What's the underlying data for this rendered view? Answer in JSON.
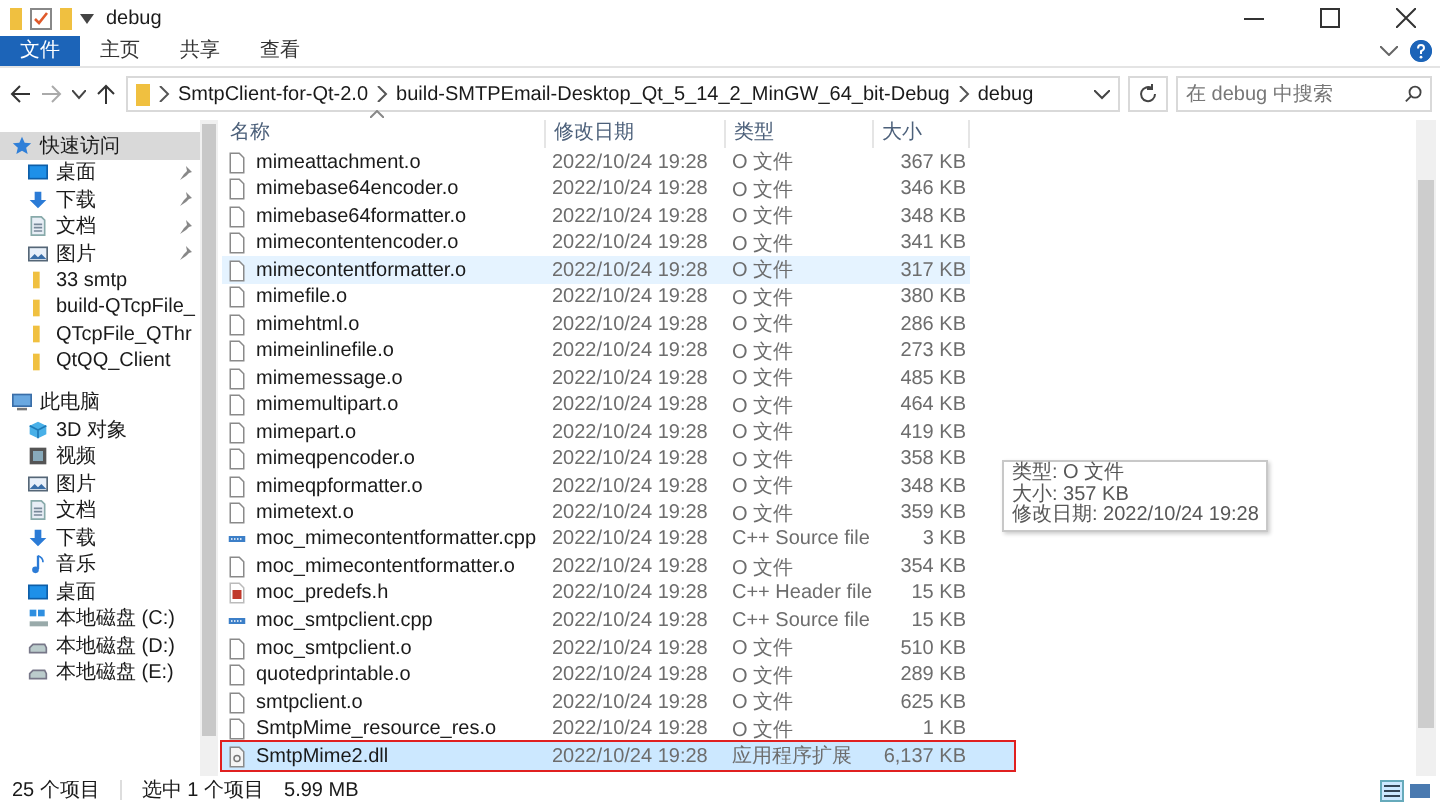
{
  "window": {
    "title": "debug"
  },
  "ribbon_tabs": [
    {
      "label": "文件",
      "selected": true
    },
    {
      "label": "主页",
      "selected": false
    },
    {
      "label": "共享",
      "selected": false
    },
    {
      "label": "查看",
      "selected": false
    }
  ],
  "address_bar": {
    "crumbs": [
      "SmtpClient-for-Qt-2.0",
      "build-SMTPEmail-Desktop_Qt_5_14_2_MinGW_64_bit-Debug",
      "debug"
    ]
  },
  "search": {
    "placeholder": "在 debug 中搜索"
  },
  "sidebar": {
    "items": [
      {
        "label": "快速访问",
        "kind": "star",
        "selected": true,
        "pinned": false,
        "children": [
          {
            "label": "桌面",
            "kind": "desktop",
            "selected": false,
            "pinned": true
          },
          {
            "label": "下载",
            "kind": "download",
            "selected": false,
            "pinned": true
          },
          {
            "label": "文档",
            "kind": "document",
            "selected": false,
            "pinned": true
          },
          {
            "label": "图片",
            "kind": "pictures",
            "selected": false,
            "pinned": true
          },
          {
            "label": "33 smtp",
            "kind": "folder",
            "selected": false,
            "pinned": false
          },
          {
            "label": "build-QTcpFile_",
            "kind": "folder",
            "selected": false,
            "pinned": false
          },
          {
            "label": "QTcpFile_QThr",
            "kind": "folder",
            "selected": false,
            "pinned": false
          },
          {
            "label": "QtQQ_Client",
            "kind": "folder",
            "selected": false,
            "pinned": false
          }
        ]
      },
      {
        "label": "此电脑",
        "kind": "pc",
        "selected": false,
        "pinned": false,
        "children": [
          {
            "label": "3D 对象",
            "kind": "cube",
            "selected": false,
            "pinned": false
          },
          {
            "label": "视频",
            "kind": "video",
            "selected": false,
            "pinned": false
          },
          {
            "label": "图片",
            "kind": "pictures",
            "selected": false,
            "pinned": false
          },
          {
            "label": "文档",
            "kind": "document",
            "selected": false,
            "pinned": false
          },
          {
            "label": "下载",
            "kind": "download",
            "selected": false,
            "pinned": false
          },
          {
            "label": "音乐",
            "kind": "music",
            "selected": false,
            "pinned": false
          },
          {
            "label": "桌面",
            "kind": "desktop",
            "selected": false,
            "pinned": false
          },
          {
            "label": "本地磁盘 (C:)",
            "kind": "sysdrive",
            "selected": false,
            "pinned": false
          },
          {
            "label": "本地磁盘 (D:)",
            "kind": "drive",
            "selected": false,
            "pinned": false
          },
          {
            "label": "本地磁盘 (E:)",
            "kind": "drive",
            "selected": false,
            "pinned": false
          }
        ]
      }
    ]
  },
  "table": {
    "columns": [
      "名称",
      "修改日期",
      "类型",
      "大小"
    ],
    "rows": [
      {
        "name": "mimeattachment.o",
        "modified": "2022/10/24 19:28",
        "type": "O 文件",
        "size": "367 KB",
        "kind": "file",
        "selected": false,
        "hovered": false,
        "outlined": false
      },
      {
        "name": "mimebase64encoder.o",
        "modified": "2022/10/24 19:28",
        "type": "O 文件",
        "size": "346 KB",
        "kind": "file",
        "selected": false,
        "hovered": false,
        "outlined": false
      },
      {
        "name": "mimebase64formatter.o",
        "modified": "2022/10/24 19:28",
        "type": "O 文件",
        "size": "348 KB",
        "kind": "file",
        "selected": false,
        "hovered": false,
        "outlined": false
      },
      {
        "name": "mimecontentencoder.o",
        "modified": "2022/10/24 19:28",
        "type": "O 文件",
        "size": "341 KB",
        "kind": "file",
        "selected": false,
        "hovered": false,
        "outlined": false
      },
      {
        "name": "mimecontentformatter.o",
        "modified": "2022/10/24 19:28",
        "type": "O 文件",
        "size": "317 KB",
        "kind": "file",
        "selected": false,
        "hovered": true,
        "outlined": false
      },
      {
        "name": "mimefile.o",
        "modified": "2022/10/24 19:28",
        "type": "O 文件",
        "size": "380 KB",
        "kind": "file",
        "selected": false,
        "hovered": false,
        "outlined": false
      },
      {
        "name": "mimehtml.o",
        "modified": "2022/10/24 19:28",
        "type": "O 文件",
        "size": "286 KB",
        "kind": "file",
        "selected": false,
        "hovered": false,
        "outlined": false
      },
      {
        "name": "mimeinlinefile.o",
        "modified": "2022/10/24 19:28",
        "type": "O 文件",
        "size": "273 KB",
        "kind": "file",
        "selected": false,
        "hovered": false,
        "outlined": false
      },
      {
        "name": "mimemessage.o",
        "modified": "2022/10/24 19:28",
        "type": "O 文件",
        "size": "485 KB",
        "kind": "file",
        "selected": false,
        "hovered": false,
        "outlined": false
      },
      {
        "name": "mimemultipart.o",
        "modified": "2022/10/24 19:28",
        "type": "O 文件",
        "size": "464 KB",
        "kind": "file",
        "selected": false,
        "hovered": false,
        "outlined": false
      },
      {
        "name": "mimepart.o",
        "modified": "2022/10/24 19:28",
        "type": "O 文件",
        "size": "419 KB",
        "kind": "file",
        "selected": false,
        "hovered": false,
        "outlined": false
      },
      {
        "name": "mimeqpencoder.o",
        "modified": "2022/10/24 19:28",
        "type": "O 文件",
        "size": "358 KB",
        "kind": "file",
        "selected": false,
        "hovered": false,
        "outlined": false
      },
      {
        "name": "mimeqpformatter.o",
        "modified": "2022/10/24 19:28",
        "type": "O 文件",
        "size": "348 KB",
        "kind": "file",
        "selected": false,
        "hovered": false,
        "outlined": false
      },
      {
        "name": "mimetext.o",
        "modified": "2022/10/24 19:28",
        "type": "O 文件",
        "size": "359 KB",
        "kind": "file",
        "selected": false,
        "hovered": false,
        "outlined": false
      },
      {
        "name": "moc_mimecontentformatter.cpp",
        "modified": "2022/10/24 19:28",
        "type": "C++ Source file",
        "size": "3 KB",
        "kind": "cpp",
        "selected": false,
        "hovered": false,
        "outlined": false
      },
      {
        "name": "moc_mimecontentformatter.o",
        "modified": "2022/10/24 19:28",
        "type": "O 文件",
        "size": "354 KB",
        "kind": "file",
        "selected": false,
        "hovered": false,
        "outlined": false
      },
      {
        "name": "moc_predefs.h",
        "modified": "2022/10/24 19:28",
        "type": "C++ Header file",
        "size": "15 KB",
        "kind": "header",
        "selected": false,
        "hovered": false,
        "outlined": false
      },
      {
        "name": "moc_smtpclient.cpp",
        "modified": "2022/10/24 19:28",
        "type": "C++ Source file",
        "size": "15 KB",
        "kind": "cpp",
        "selected": false,
        "hovered": false,
        "outlined": false
      },
      {
        "name": "moc_smtpclient.o",
        "modified": "2022/10/24 19:28",
        "type": "O 文件",
        "size": "510 KB",
        "kind": "file",
        "selected": false,
        "hovered": false,
        "outlined": false
      },
      {
        "name": "quotedprintable.o",
        "modified": "2022/10/24 19:28",
        "type": "O 文件",
        "size": "289 KB",
        "kind": "file",
        "selected": false,
        "hovered": false,
        "outlined": false
      },
      {
        "name": "smtpclient.o",
        "modified": "2022/10/24 19:28",
        "type": "O 文件",
        "size": "625 KB",
        "kind": "file",
        "selected": false,
        "hovered": false,
        "outlined": false
      },
      {
        "name": "SmtpMime_resource_res.o",
        "modified": "2022/10/24 19:28",
        "type": "O 文件",
        "size": "1 KB",
        "kind": "file",
        "selected": false,
        "hovered": false,
        "outlined": false
      },
      {
        "name": "SmtpMime2.dll",
        "modified": "2022/10/24 19:28",
        "type": "应用程序扩展",
        "size": "6,137 KB",
        "kind": "dll",
        "selected": true,
        "hovered": false,
        "outlined": true
      }
    ]
  },
  "tooltip": {
    "lines": [
      "类型: O 文件",
      "大小: 357 KB",
      "修改日期: 2022/10/24 19:28"
    ]
  },
  "status_bar": {
    "item_count": "25 个项目",
    "selection": "选中 1 个项目",
    "selection_size": "5.99 MB"
  }
}
